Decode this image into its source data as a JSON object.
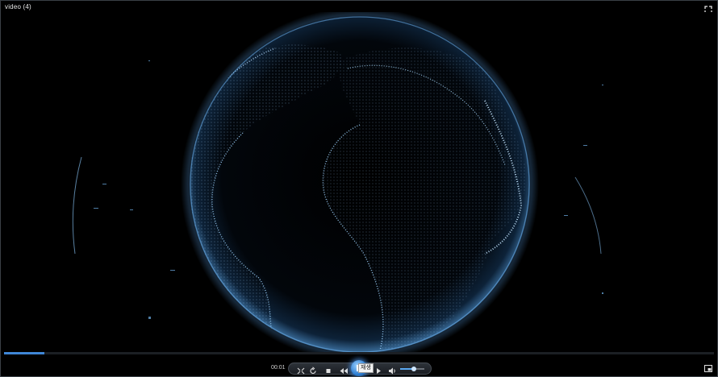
{
  "window": {
    "title": "video (4)"
  },
  "player": {
    "current_time": "00:01",
    "progress": 0.057,
    "volume": 0.55,
    "tooltip": "재생",
    "accent_color": "#3f86d6",
    "globe_color": "#7fc2ff"
  },
  "icons": {
    "fullscreen": "fullscreen-icon",
    "capture": "capture-icon",
    "repeat": "repeat-icon",
    "stop": "stop-icon",
    "rewind": "rewind-icon",
    "play": "play-icon",
    "forward": "forward-icon",
    "volume": "speaker-icon",
    "pip": "pip-icon"
  }
}
